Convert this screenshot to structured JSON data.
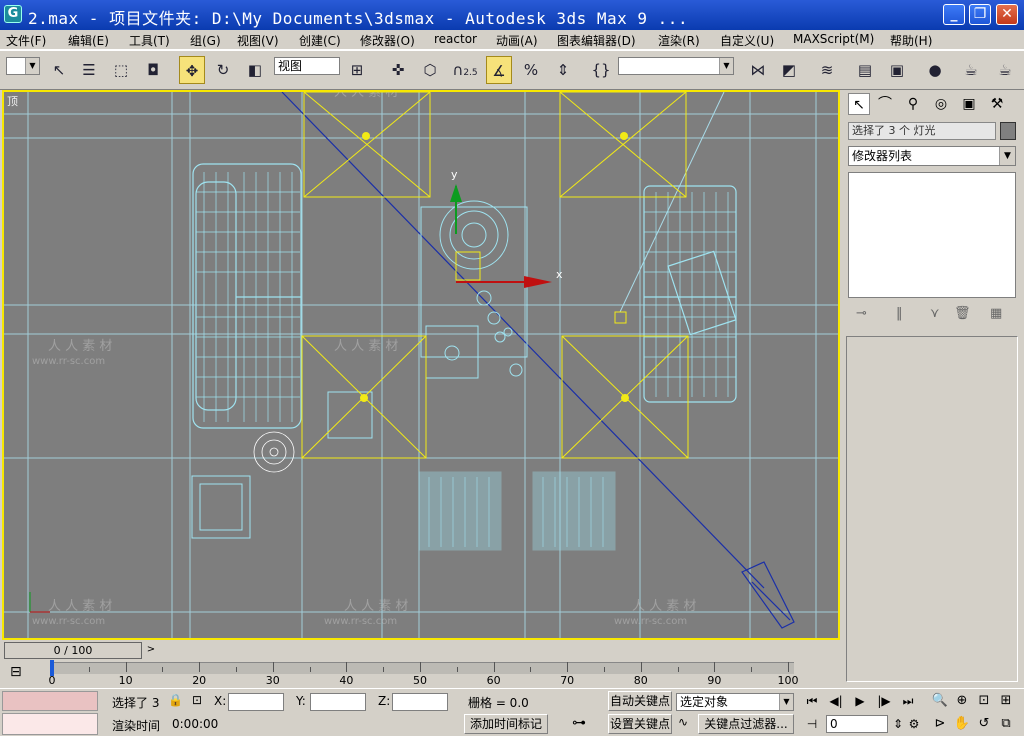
{
  "window": {
    "title": "2.max     - 项目文件夹: D:\\My Documents\\3dsmax     - Autodesk 3ds Max 9     ...",
    "app_icon": "3ds-max-icon",
    "controls": {
      "minimize": "_",
      "restore": "❐",
      "close": "✕"
    }
  },
  "menu": [
    "文件(F)",
    "编辑(E)",
    "工具(T)",
    "组(G)",
    "视图(V)",
    "创建(C)",
    "修改器(O)",
    "reactor",
    "动画(A)",
    "图表编辑器(D)",
    "渲染(R)",
    "自定义(U)",
    "MAXScript(M)",
    "帮助(H)"
  ],
  "toolbar": {
    "coord_system": "视图",
    "snap_value": "2.5"
  },
  "viewport": {
    "label": "顶",
    "watermark_text": "人 人 素 材",
    "watermark_url": "www.rr-sc.com",
    "axis_x": "x",
    "axis_y": "y"
  },
  "command_panel": {
    "selection_name": "选择了 3 个 灯光",
    "modifier_list": "修改器列表"
  },
  "time_slider": {
    "frame_display": "0 / 100",
    "ticks": [
      "0",
      "10",
      "20",
      "30",
      "40",
      "50",
      "60",
      "70",
      "80",
      "90",
      "100"
    ]
  },
  "status": {
    "selected_prefix": "选择了 3",
    "x_label": "X:",
    "y_label": "Y:",
    "z_label": "Z:",
    "grid": "栅格 = 0.0",
    "render_time_label": "渲染时间",
    "render_time_value": "0:00:00",
    "add_time_tag": "添加时间标记",
    "auto_key": "自动关键点",
    "set_key": "设置关键点",
    "selected_object": "选定对象",
    "key_filters": "关键点过滤器...",
    "current_frame": "0"
  }
}
